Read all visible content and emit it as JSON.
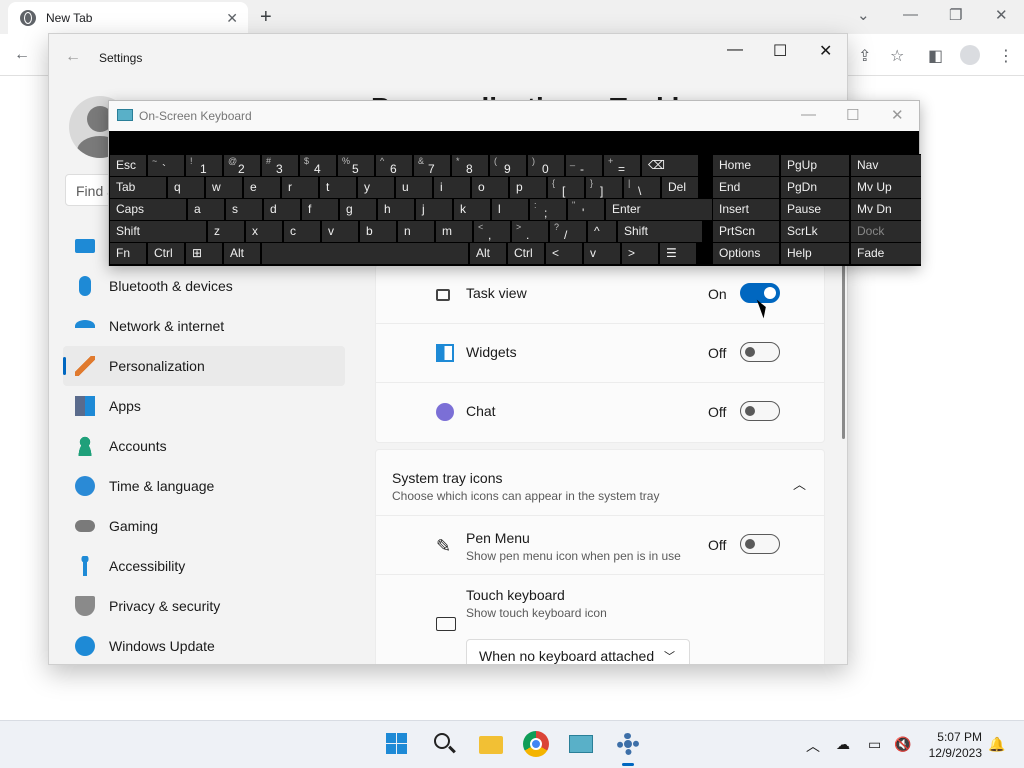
{
  "browser": {
    "tab_title": "New Tab",
    "new_tab_label": "+"
  },
  "settings": {
    "window_title": "Settings",
    "search_placeholder": "Find a",
    "page_title": "Personalization > Taskbar",
    "nav": [
      {
        "label": "",
        "icon": "system-icon"
      },
      {
        "label": "Bluetooth & devices",
        "icon": "bluetooth-icon"
      },
      {
        "label": "Network & internet",
        "icon": "wifi-icon"
      },
      {
        "label": "Personalization",
        "icon": "brush-icon",
        "active": true
      },
      {
        "label": "Apps",
        "icon": "apps-icon"
      },
      {
        "label": "Accounts",
        "icon": "person-icon"
      },
      {
        "label": "Time & language",
        "icon": "globe-clock-icon"
      },
      {
        "label": "Gaming",
        "icon": "gamepad-icon"
      },
      {
        "label": "Accessibility",
        "icon": "accessibility-icon"
      },
      {
        "label": "Privacy & security",
        "icon": "shield-icon"
      },
      {
        "label": "Windows Update",
        "icon": "update-icon"
      }
    ],
    "taskbar_items": [
      {
        "label": "Task view",
        "state": "On",
        "on": true
      },
      {
        "label": "Widgets",
        "state": "Off",
        "on": false
      },
      {
        "label": "Chat",
        "state": "Off",
        "on": false
      }
    ],
    "system_tray": {
      "title": "System tray icons",
      "subtitle": "Choose which icons can appear in the system tray",
      "pen_menu": {
        "label": "Pen Menu",
        "sub": "Show pen menu icon when pen is in use",
        "state": "Off"
      },
      "touch_keyboard": {
        "label": "Touch keyboard",
        "sub": "Show touch keyboard icon",
        "dropdown_value": "When no keyboard attached"
      }
    }
  },
  "osk": {
    "title": "On-Screen Keyboard",
    "rows": [
      [
        [
          "Esc",
          ""
        ],
        [
          "`",
          "~"
        ],
        [
          "1",
          "!"
        ],
        [
          "2",
          "@"
        ],
        [
          "3",
          "#"
        ],
        [
          "4",
          "$"
        ],
        [
          "5",
          "%"
        ],
        [
          "6",
          "^"
        ],
        [
          "7",
          "&"
        ],
        [
          "8",
          "*"
        ],
        [
          "9",
          "("
        ],
        [
          "0",
          ")"
        ],
        [
          "-",
          "_"
        ],
        [
          "=",
          "+"
        ],
        [
          "⌫",
          ""
        ]
      ],
      [
        [
          "Tab",
          ""
        ],
        [
          "q",
          ""
        ],
        [
          "w",
          ""
        ],
        [
          "e",
          ""
        ],
        [
          "r",
          ""
        ],
        [
          "t",
          ""
        ],
        [
          "y",
          ""
        ],
        [
          "u",
          ""
        ],
        [
          "i",
          ""
        ],
        [
          "o",
          ""
        ],
        [
          "p",
          ""
        ],
        [
          "[",
          "{"
        ],
        [
          "]",
          "}"
        ],
        [
          "\\",
          "|"
        ],
        [
          "Del",
          ""
        ]
      ],
      [
        [
          "Caps",
          ""
        ],
        [
          "a",
          ""
        ],
        [
          "s",
          ""
        ],
        [
          "d",
          ""
        ],
        [
          "f",
          ""
        ],
        [
          "g",
          ""
        ],
        [
          "h",
          ""
        ],
        [
          "j",
          ""
        ],
        [
          "k",
          ""
        ],
        [
          "l",
          ""
        ],
        [
          ";",
          ":"
        ],
        [
          "'",
          "\""
        ],
        [
          "Enter",
          ""
        ]
      ],
      [
        [
          "Shift",
          ""
        ],
        [
          "z",
          ""
        ],
        [
          "x",
          ""
        ],
        [
          "c",
          ""
        ],
        [
          "v",
          ""
        ],
        [
          "b",
          ""
        ],
        [
          "n",
          ""
        ],
        [
          "m",
          ""
        ],
        [
          ",",
          "<"
        ],
        [
          ".",
          ">"
        ],
        [
          "/",
          "?"
        ],
        [
          "^",
          ""
        ],
        [
          "Shift",
          ""
        ]
      ],
      [
        [
          "Fn",
          ""
        ],
        [
          "Ctrl",
          ""
        ],
        [
          "⊞",
          ""
        ],
        [
          "Alt",
          ""
        ],
        [
          "",
          ""
        ],
        [
          "Alt",
          ""
        ],
        [
          "Ctrl",
          ""
        ],
        [
          "<",
          ""
        ],
        [
          "v",
          ""
        ],
        [
          ">",
          ""
        ],
        [
          "☰",
          ""
        ]
      ]
    ],
    "nav_keys": [
      [
        "Home",
        "PgUp",
        "Nav"
      ],
      [
        "End",
        "PgDn",
        "Mv Up"
      ],
      [
        "Insert",
        "Pause",
        "Mv Dn"
      ],
      [
        "PrtScn",
        "ScrLk",
        "Dock"
      ],
      [
        "Options",
        "Help",
        "Fade"
      ]
    ]
  },
  "taskbar": {
    "time": "5:07 PM",
    "date": "12/9/2023"
  }
}
